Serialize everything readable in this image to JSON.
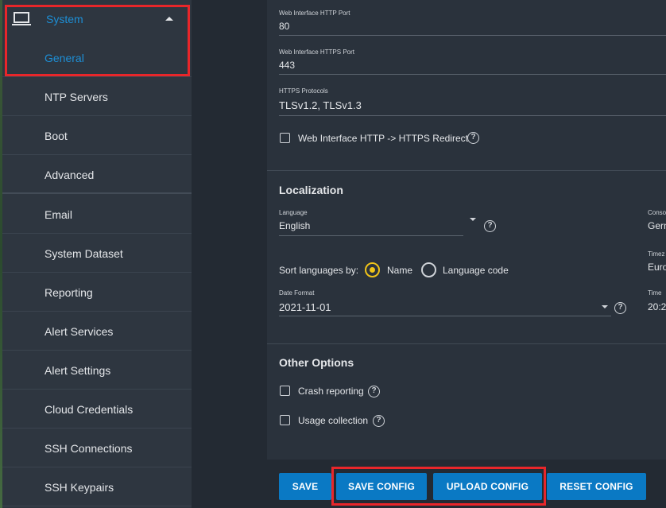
{
  "sidebar": {
    "parent": {
      "label": "System"
    },
    "items": [
      {
        "label": "General",
        "active": true
      },
      {
        "label": "NTP Servers"
      },
      {
        "label": "Boot"
      },
      {
        "label": "Advanced"
      },
      {
        "label": "Email"
      },
      {
        "label": "System Dataset"
      },
      {
        "label": "Reporting"
      },
      {
        "label": "Alert Services"
      },
      {
        "label": "Alert Settings"
      },
      {
        "label": "Cloud Credentials"
      },
      {
        "label": "SSH Connections"
      },
      {
        "label": "SSH Keypairs"
      }
    ]
  },
  "gui": {
    "http_port_label": "Web Interface HTTP Port",
    "http_port_value": "80",
    "https_port_label": "Web Interface HTTPS Port",
    "https_port_value": "443",
    "protocols_label": "HTTPS Protocols",
    "protocols_value": "TLSv1.2, TLSv1.3",
    "redirect_label": "Web Interface HTTP -> HTTPS Redirect"
  },
  "localization": {
    "title": "Localization",
    "language_label": "Language",
    "language_value": "English",
    "console_label_partial": "Conso",
    "console_value_partial": "Gern",
    "sort_label": "Sort languages by:",
    "sort_option_name": "Name",
    "sort_option_code": "Language code",
    "timezone_label_partial": "Timez",
    "timezone_value_partial": "Euro",
    "date_format_label": "Date Format",
    "date_format_value": "2021-11-01",
    "time_label_partial": "Time",
    "time_value_partial": "20:2"
  },
  "other": {
    "title": "Other Options",
    "crash_label": "Crash reporting",
    "usage_label": "Usage collection"
  },
  "buttons": {
    "save": "SAVE",
    "save_config": "SAVE CONFIG",
    "upload_config": "UPLOAD CONFIG",
    "reset_config": "RESET CONFIG"
  },
  "icons": {
    "help_glyph": "?"
  },
  "colors": {
    "accent": "#1d8fd6",
    "button": "#0a79c4",
    "radio": "#f0c419",
    "highlight": "#e8262a"
  }
}
